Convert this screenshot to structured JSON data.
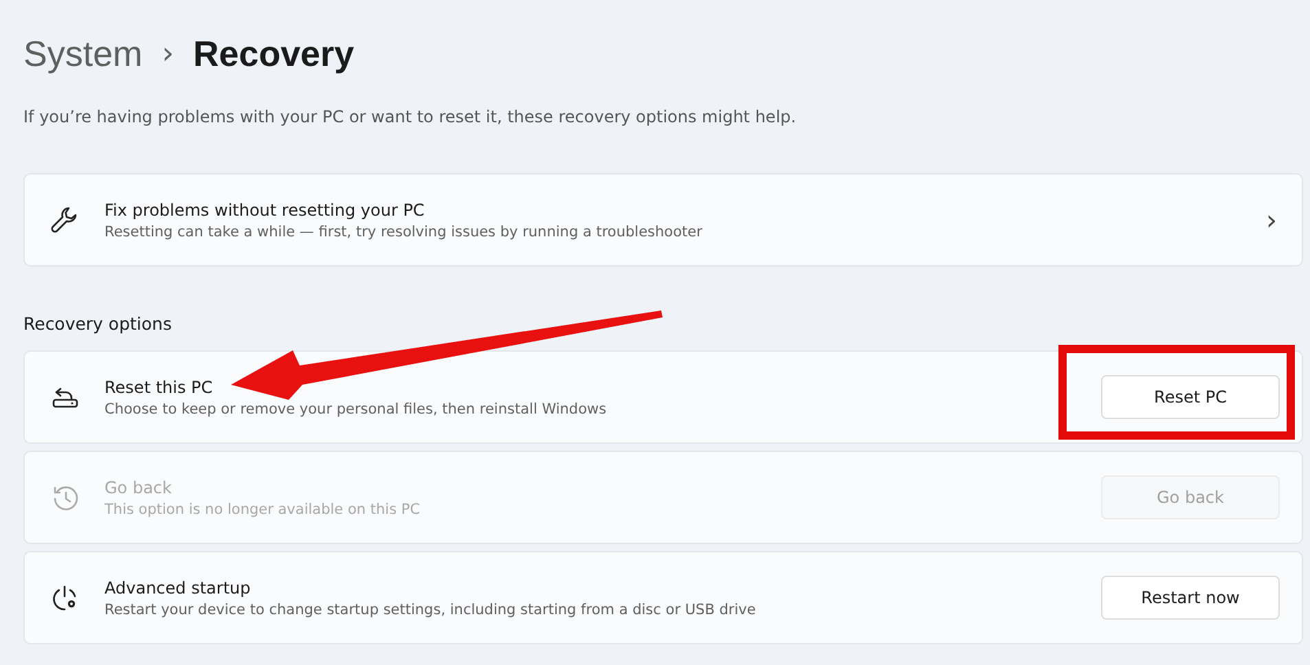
{
  "breadcrumb": {
    "parent": "System",
    "separator": "›",
    "current": "Recovery"
  },
  "description": "If you’re having problems with your PC or want to reset it, these recovery options might help.",
  "help_card": {
    "title": "Fix problems without resetting your PC",
    "subtitle": "Resetting can take a while — first, try resolving issues by running a troubleshooter",
    "chevron": "›"
  },
  "section_heading": "Recovery options",
  "options": [
    {
      "title": "Reset this PC",
      "subtitle": "Choose to keep or remove your personal files, then reinstall Windows",
      "button": "Reset PC",
      "disabled": false,
      "highlighted": true
    },
    {
      "title": "Go back",
      "subtitle": "This option is no longer available on this PC",
      "button": "Go back",
      "disabled": true,
      "highlighted": false
    },
    {
      "title": "Advanced startup",
      "subtitle": "Restart your device to change startup settings, including starting from a disc or USB drive",
      "button": "Restart now",
      "disabled": false,
      "highlighted": false
    }
  ]
}
